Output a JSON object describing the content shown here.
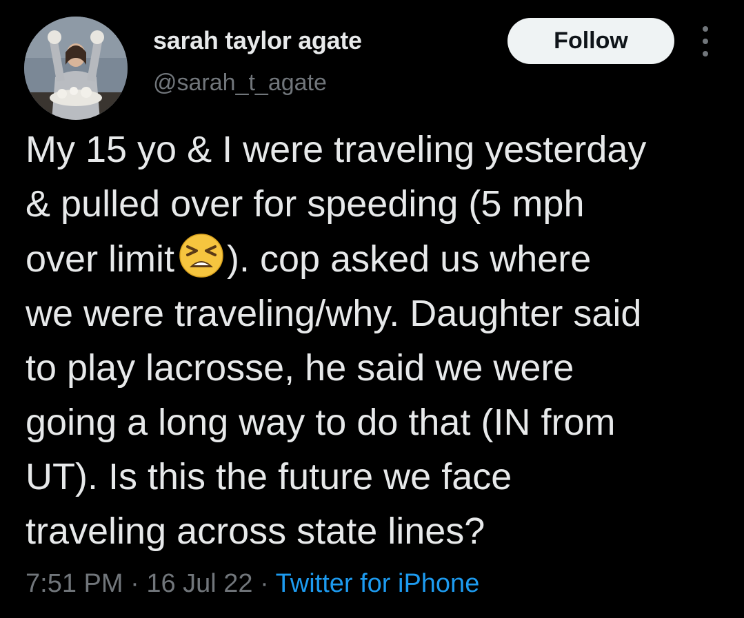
{
  "author": {
    "display_name": "sarah taylor agate",
    "handle": "@sarah_t_agate"
  },
  "actions": {
    "follow_label": "Follow",
    "more_icon": "more-vertical-icon"
  },
  "tweet": {
    "lines": [
      "My 15 yo & I were traveling yesterday",
      "& pulled over for speeding (5 mph",
      "over limit",
      "). cop asked us where",
      "we were traveling/why. Daughter said",
      "to play lacrosse, he said we were",
      "going a long way to do that (IN from",
      "UT). Is this the future we face",
      "traveling across state lines?"
    ],
    "emoji": "tired-face-emoji"
  },
  "meta": {
    "time": "7:51 PM",
    "separator": " · ",
    "date": "16 Jul 22",
    "source": "Twitter for iPhone"
  },
  "colors": {
    "background": "#000000",
    "text": "#e7e9ea",
    "secondary": "#71767b",
    "link": "#1d9bf0",
    "follow_bg": "#eff3f4"
  }
}
